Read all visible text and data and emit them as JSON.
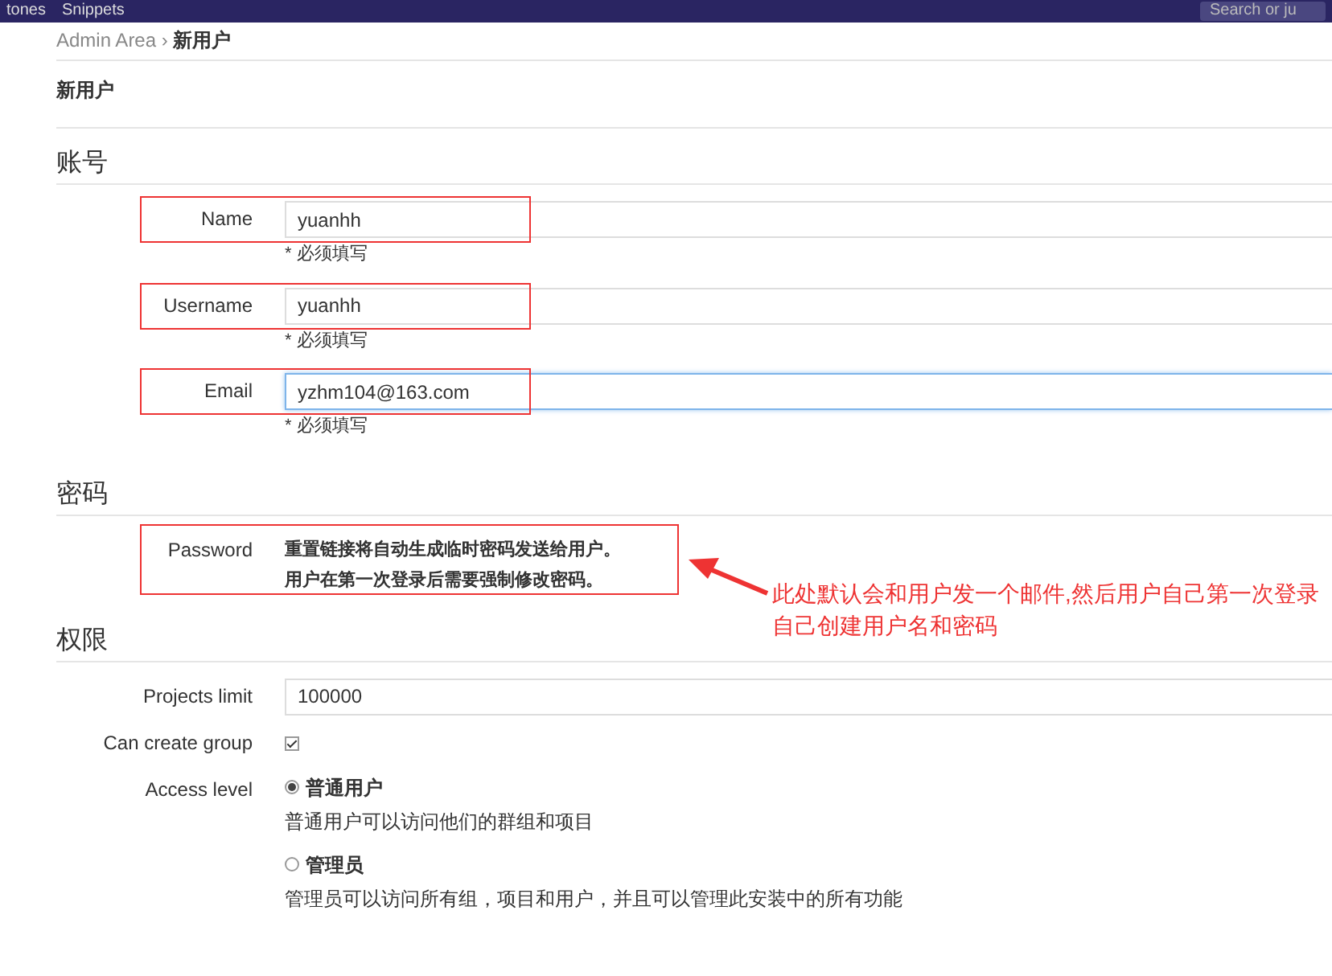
{
  "navbar": {
    "items": [
      "tones",
      "Snippets"
    ],
    "search": {
      "placeholder": "Search or ju"
    }
  },
  "breadcrumb": {
    "items": [
      "Admin Area",
      "新用户"
    ],
    "separator": "›"
  },
  "page_title": "新用户",
  "sections": [
    {
      "title": "账号",
      "fields": [
        {
          "kind": "text",
          "label": "Name",
          "value": "yuanhh",
          "hint": "* 必须填写",
          "focused": false,
          "highlighted": true
        },
        {
          "kind": "text",
          "label": "Username",
          "value": "yuanhh",
          "hint": "* 必须填写",
          "focused": false,
          "highlighted": true
        },
        {
          "kind": "text",
          "label": "Email",
          "value": "yzhm104@163.com",
          "hint": "* 必须填写",
          "focused": true,
          "highlighted": true
        }
      ]
    },
    {
      "title": "密码",
      "fields": [
        {
          "kind": "note",
          "label": "Password",
          "lines": [
            "重置链接将自动生成临时密码发送给用户。",
            "用户在第一次登录后需要强制修改密码。"
          ],
          "highlighted": true,
          "annotation": "此处默认会和用户发一个邮件,然后用户自己第一次登录自己创建用户名和密码"
        }
      ]
    },
    {
      "title": "权限",
      "fields": [
        {
          "kind": "text",
          "label": "Projects limit",
          "value": "100000",
          "focused": false
        },
        {
          "kind": "checkbox",
          "label": "Can create group",
          "checked": true
        },
        {
          "kind": "radio",
          "label": "Access level",
          "options": [
            {
              "label": "普通用户",
              "description": "普通用户可以访问他们的群组和项目",
              "selected": true
            },
            {
              "label": "管理员",
              "description": "管理员可以访问所有组，项目和用户，并且可以管理此安装中的所有功能",
              "selected": false
            }
          ]
        }
      ]
    }
  ]
}
